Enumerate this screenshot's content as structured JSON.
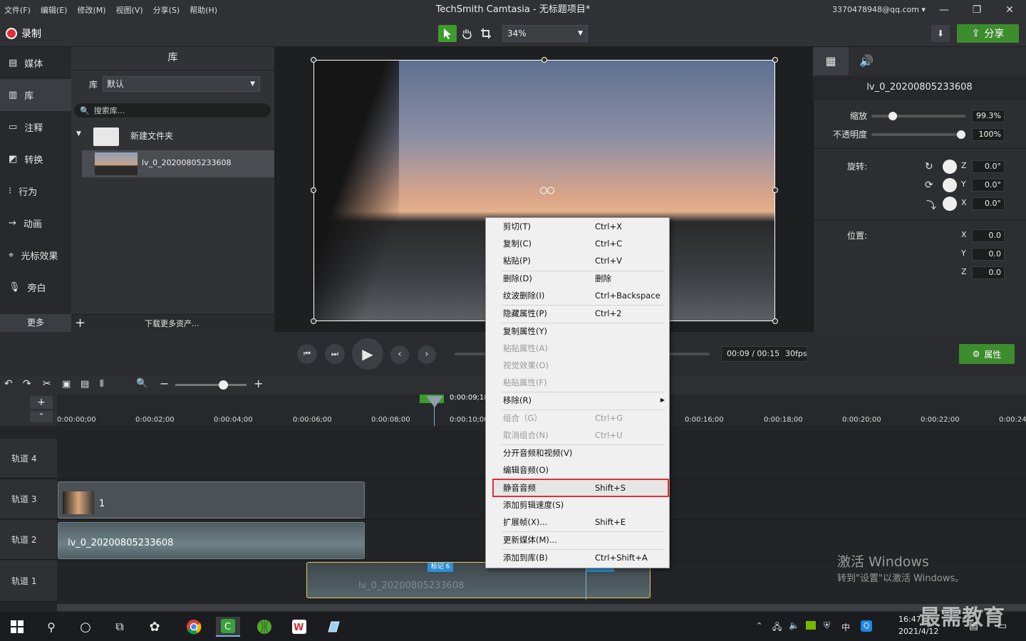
{
  "menu": [
    "文件(F)",
    "编辑(E)",
    "修改(M)",
    "视图(V)",
    "分享(S)",
    "帮助(H)"
  ],
  "window_title": "TechSmith Camtasia - 无标题项目*",
  "account": "3370478948@qq.com ▾",
  "record_label": "录制",
  "zoom": "34%",
  "share_label": "分享",
  "nav": [
    "媒体",
    "库",
    "注释",
    "转换",
    "行为",
    "动画",
    "光标效果",
    "旁白"
  ],
  "nav_more": "更多",
  "library": {
    "title": "库",
    "lib_label": "库",
    "lib_select": "默认",
    "search_placeholder": "搜索库...",
    "folder": "新建文件夹",
    "item": "lv_0_20200805233608",
    "download": "下载更多资产..."
  },
  "props": {
    "title": "lv_0_20200805233608",
    "scale_label": "缩放",
    "scale": "99.3%",
    "opacity_label": "不透明度",
    "opacity": "100%",
    "rotate_label": "旋转:",
    "rz": "0.0°",
    "ry": "0.0°",
    "rx": "0.0°",
    "pos_label": "位置:",
    "px": "0.0",
    "py": "0.0",
    "pz": "0.0",
    "axes": [
      "Z",
      "Y",
      "X",
      "X",
      "Y",
      "Z"
    ]
  },
  "player": {
    "time": "00:09 / 00:15",
    "fps": "30fps",
    "props_btn": "属性"
  },
  "timeline": {
    "playhead": "0:00:09;18",
    "markers_label": "标记",
    "ticks": [
      "0:00:00;00",
      "0:00:02;00",
      "0:00:04;00",
      "0:00:06;00",
      "0:00:08;00",
      "0:00:10;00",
      "0:00:16;00",
      "0:00:18;00",
      "0:00:20;00",
      "0:00:22;00",
      "0:00:24"
    ],
    "tracks": [
      "轨道 4",
      "轨道 3",
      "轨道 2",
      "轨道 1"
    ],
    "clip3": "1",
    "clip2": "lv_0_20200805233608",
    "clip1": "lv_0_20200805233608",
    "marker6": "标记 6"
  },
  "context_menu": [
    {
      "label": "剪切(T)",
      "shortcut": "Ctrl+X",
      "enabled": true
    },
    {
      "label": "复制(C)",
      "shortcut": "Ctrl+C",
      "enabled": true
    },
    {
      "label": "粘贴(P)",
      "shortcut": "Ctrl+V",
      "enabled": true
    },
    {
      "label": "删除(D)",
      "shortcut": "删除",
      "enabled": true
    },
    {
      "label": "纹波删除(I)",
      "shortcut": "Ctrl+Backspace",
      "enabled": true
    },
    {
      "label": "隐藏属性(P)",
      "shortcut": "Ctrl+2",
      "enabled": true
    },
    {
      "label": "复制属性(Y)",
      "shortcut": "",
      "enabled": true
    },
    {
      "label": "粘贴属性(A)",
      "shortcut": "",
      "enabled": false
    },
    {
      "label": "视觉效果(O)",
      "shortcut": "",
      "enabled": false
    },
    {
      "label": "粘贴属性(F)",
      "shortcut": "",
      "enabled": false
    },
    {
      "label": "移除(R)",
      "shortcut": "",
      "enabled": true
    },
    {
      "label": "组合（G）",
      "shortcut": "Ctrl+G",
      "enabled": false
    },
    {
      "label": "取消组合(N)",
      "shortcut": "Ctrl+U",
      "enabled": false
    },
    {
      "label": "分开音频和视频(V)",
      "shortcut": "",
      "enabled": true
    },
    {
      "label": "编辑音频(O)",
      "shortcut": "",
      "enabled": true
    },
    {
      "label": "静音音频",
      "shortcut": "Shift+S",
      "enabled": true
    },
    {
      "label": "添加剪辑速度(S)",
      "shortcut": "",
      "enabled": true
    },
    {
      "label": "扩展帧(X)...",
      "shortcut": "Shift+E",
      "enabled": true
    },
    {
      "label": "更新媒体(M)...",
      "shortcut": "",
      "enabled": true
    },
    {
      "label": "添加到库(B)",
      "shortcut": "Ctrl+Shift+A",
      "enabled": true
    }
  ],
  "watermark": {
    "line1": "激活 Windows",
    "line2": "转到\"设置\"以激活 Windows。",
    "brand": "最需教育"
  },
  "taskbar": {
    "time": "16:47",
    "date": "2021/4/12",
    "ime": "中"
  }
}
